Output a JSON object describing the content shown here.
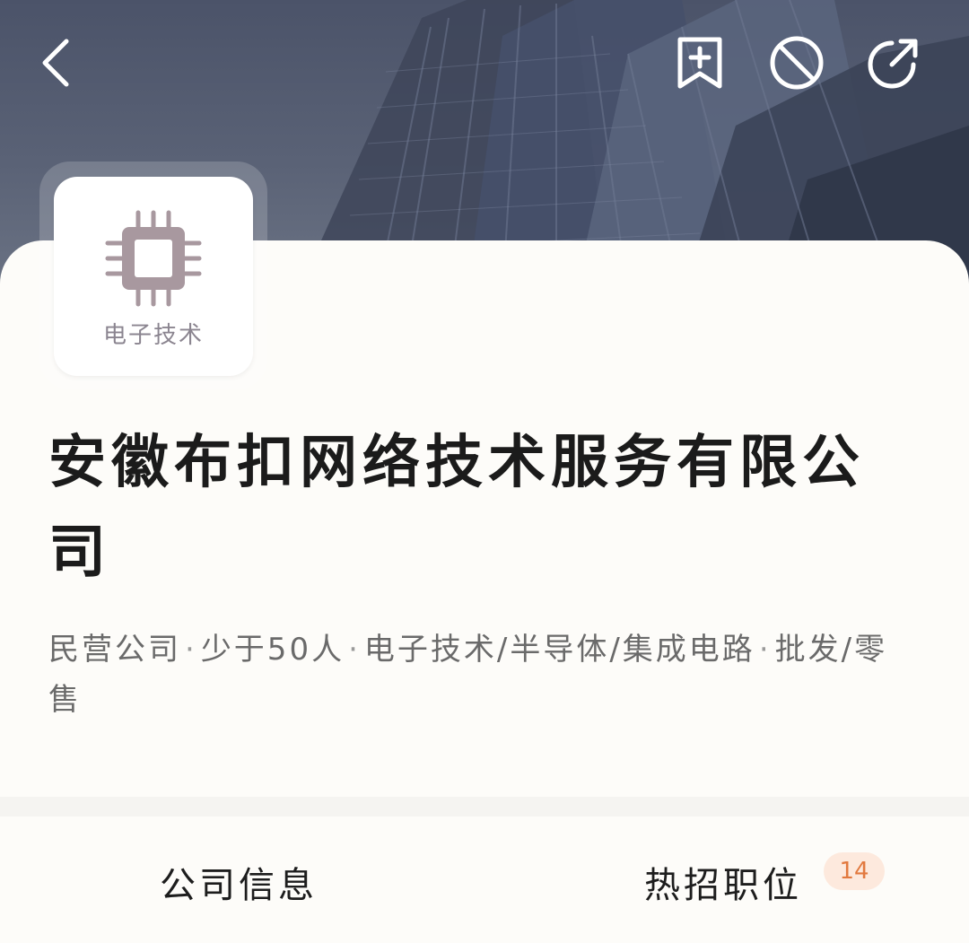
{
  "header": {
    "icons": {
      "back": "chevron-left-icon",
      "bookmark": "bookmark-plus-icon",
      "block": "block-icon",
      "share": "share-icon"
    },
    "background": "building-photo"
  },
  "company": {
    "logo_label": "电子技术",
    "logo_icon": "chip-icon",
    "name": "安徽布扣网络技术服务有限公司",
    "tags": [
      "民营公司",
      "少于50人",
      "电子技术/半导体/集成电路",
      "批发/零售"
    ]
  },
  "tabs": [
    {
      "label": "公司信息"
    },
    {
      "label": "热招职位",
      "badge": "14"
    }
  ],
  "colors": {
    "header": "#4b5369",
    "badge_bg": "#fde9dd",
    "badge_text": "#e2793f",
    "logo_icon": "#a8989f"
  }
}
